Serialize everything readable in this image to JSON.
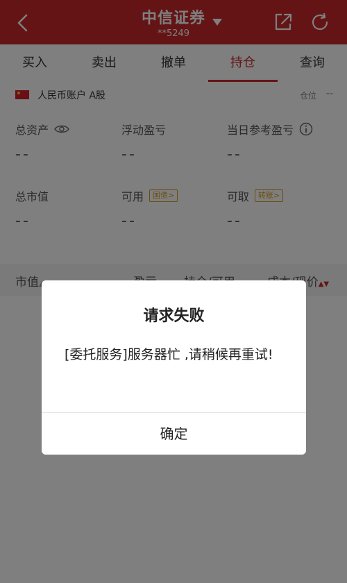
{
  "header": {
    "title": "中信证券",
    "account_masked": "**5249"
  },
  "tabs": [
    {
      "label": "买入"
    },
    {
      "label": "卖出"
    },
    {
      "label": "撤单"
    },
    {
      "label": "持仓",
      "active": true
    },
    {
      "label": "查询"
    }
  ],
  "account": {
    "label": "人民币账户 A股",
    "position_label": "仓位",
    "position_value": "--"
  },
  "stats": {
    "total_assets": {
      "label": "总资产",
      "value": "--"
    },
    "floating_pnl": {
      "label": "浮动盈亏",
      "value": "--"
    },
    "daily_ref_pnl": {
      "label": "当日参考盈亏",
      "value": "--"
    },
    "market_value": {
      "label": "总市值",
      "value": "--"
    },
    "available": {
      "label": "可用",
      "value": "--",
      "chip": "国债>"
    },
    "withdrawable": {
      "label": "可取",
      "value": "--",
      "chip": "转账>"
    }
  },
  "list_header": {
    "col1": "市值",
    "col2": "盈亏",
    "col3": "持仓/可用",
    "col4": "成本/现价"
  },
  "dialog": {
    "title": "请求失败",
    "message": "[委托服务]服务器忙 ,请稍候再重试!",
    "confirm": "确定"
  },
  "colors": {
    "brand": "#c8282a",
    "chip": "#d59b1f",
    "overlay": "rgba(0,0,0,0.5)"
  }
}
